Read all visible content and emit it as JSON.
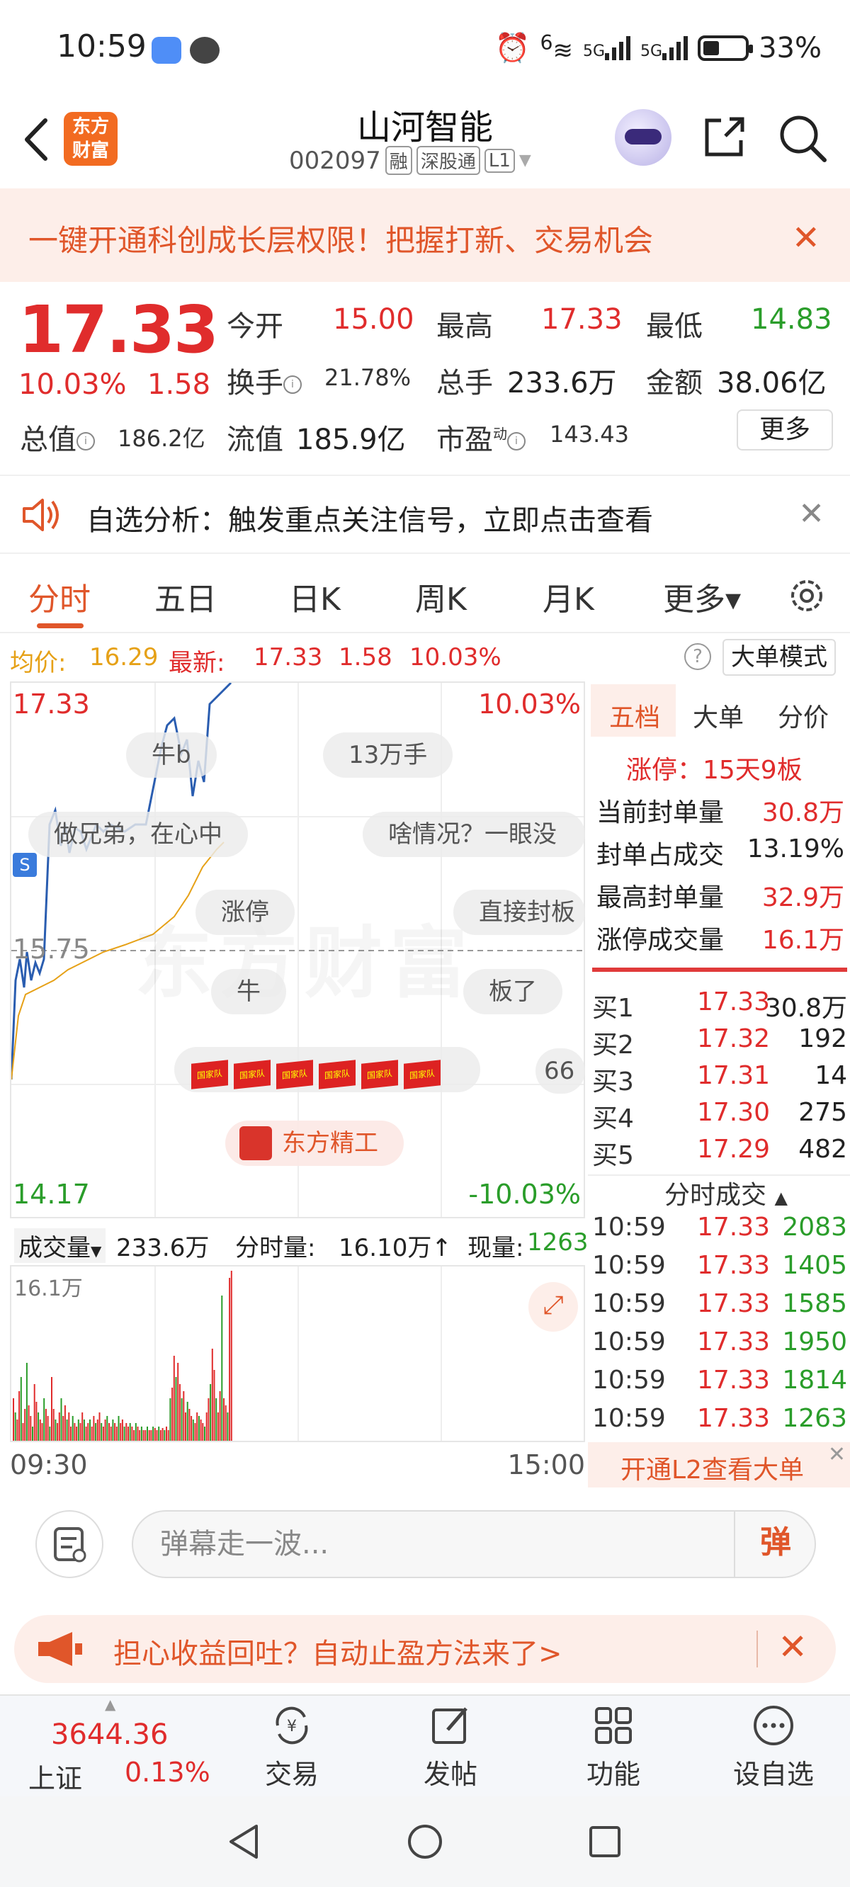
{
  "status": {
    "time": "10:59",
    "signal1": "6",
    "signal2": "5G",
    "signal3": "5G",
    "battery": "33%"
  },
  "header": {
    "logo_line1": "东方",
    "logo_line2": "财富",
    "stock_name": "山河智能",
    "stock_code": "002097",
    "tag_margin": "融",
    "tag_connect": "深股通",
    "tag_level": "L1"
  },
  "banner": {
    "text": "一键开通科创成长层权限！把握打新、交易机会",
    "close": "✕"
  },
  "quote": {
    "price": "17.33",
    "pct": "10.03%",
    "change": "1.58",
    "open_label": "今开",
    "open": "15.00",
    "high_label": "最高",
    "high": "17.33",
    "low_label": "最低",
    "low": "14.83",
    "turnover_label": "换手",
    "turnover": "21.78%",
    "volume_label": "总手",
    "volume": "233.6万",
    "amount_label": "金额",
    "amount": "38.06亿",
    "mktcap_label": "总值",
    "mktcap": "186.2亿",
    "float_label": "流值",
    "float": "185.9亿",
    "pe_label": "市盈",
    "pe_sup": "动",
    "pe": "143.43",
    "more": "更多"
  },
  "notice": {
    "text": "自选分析：触发重点关注信号，立即点击查看",
    "close": "✕"
  },
  "tabs": [
    "分时",
    "五日",
    "日K",
    "周K",
    "月K",
    "更多▾"
  ],
  "infoline": {
    "avg_label": "均价:",
    "avg": "16.29",
    "last_label": "最新:",
    "last": "17.33",
    "chg": "1.58",
    "pct": "10.03%",
    "help": "?",
    "mode": "大单模式"
  },
  "chart": {
    "y_top": "17.33",
    "y_mid": "15.75",
    "y_bottom": "14.17",
    "pct_top": "10.03%",
    "pct_bottom": "-10.03%",
    "watermark": "东方财富",
    "colors": {
      "price": "#2a5db0",
      "avg": "#e6a117",
      "up": "#e02c2c",
      "down": "#2a9d2a"
    }
  },
  "danmu": [
    "牛b",
    "13万手",
    "做兄弟，在心中",
    "啥情况？一眼没",
    "涨停",
    "直接封板",
    "牛",
    "板了",
    "66",
    "国家队",
    "东方精工"
  ],
  "right_panel": {
    "tabs": [
      "五档",
      "大单",
      "分价"
    ],
    "limit_title": "涨停：15天9板",
    "stats": [
      {
        "label": "当前封单量",
        "value": "30.8万"
      },
      {
        "label": "封单占成交",
        "value": "13.19%"
      },
      {
        "label": "最高封单量",
        "value": "32.9万"
      },
      {
        "label": "涨停成交量",
        "value": "16.1万"
      }
    ],
    "book": [
      {
        "label": "买1",
        "price": "17.33",
        "qty": "30.8万"
      },
      {
        "label": "买2",
        "price": "17.32",
        "qty": "192"
      },
      {
        "label": "买3",
        "price": "17.31",
        "qty": "14"
      },
      {
        "label": "买4",
        "price": "17.30",
        "qty": "275"
      },
      {
        "label": "买5",
        "price": "17.29",
        "qty": "482"
      }
    ],
    "ticks_title": "分时成交",
    "ticks": [
      {
        "time": "10:59",
        "price": "17.33",
        "qty": "2083"
      },
      {
        "time": "10:59",
        "price": "17.33",
        "qty": "1405"
      },
      {
        "time": "10:59",
        "price": "17.33",
        "qty": "1585"
      },
      {
        "time": "10:59",
        "price": "17.33",
        "qty": "1950"
      },
      {
        "time": "10:59",
        "price": "17.33",
        "qty": "1814"
      },
      {
        "time": "10:59",
        "price": "17.33",
        "qty": "1263"
      }
    ],
    "l2": "开通L2查看大单"
  },
  "volume": {
    "label": "成交量",
    "total": "233.6万",
    "period_label": "分时量:",
    "period": "16.10万↑",
    "now_label": "现量:",
    "now": "1263",
    "max": "16.1万",
    "start": "09:30",
    "end": "15:00"
  },
  "comment": {
    "placeholder": "弹幕走一波...",
    "button": "弹"
  },
  "promo": {
    "text": "担心收益回吐？自动止盈方法来了>"
  },
  "bottomnav": {
    "index_value": "3644.36",
    "index_name": "上证",
    "index_pct": "0.13%",
    "items": [
      "交易",
      "发帖",
      "功能",
      "设自选"
    ]
  }
}
